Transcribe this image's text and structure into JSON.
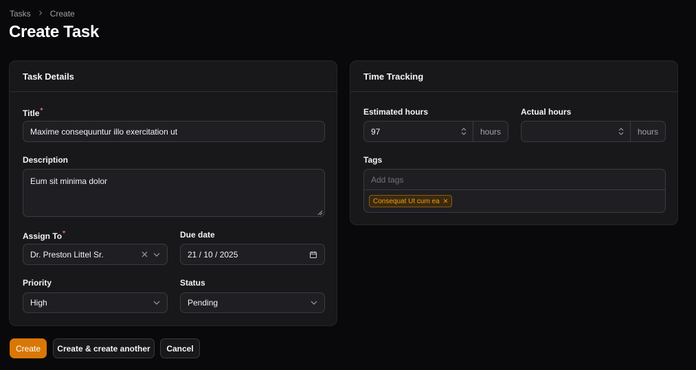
{
  "breadcrumb": {
    "items": [
      "Tasks",
      "Create"
    ]
  },
  "page": {
    "title": "Create Task"
  },
  "task_details": {
    "heading": "Task Details",
    "title": {
      "label": "Title",
      "required_mark": "*",
      "value": "Maxime consequuntur illo exercitation ut"
    },
    "description": {
      "label": "Description",
      "value": "Eum sit minima dolor"
    },
    "assign_to": {
      "label": "Assign To",
      "required_mark": "*",
      "value": "Dr. Preston Littel Sr."
    },
    "due_date": {
      "label": "Due date",
      "value": "21 / 10 / 2025"
    },
    "priority": {
      "label": "Priority",
      "value": "High"
    },
    "status": {
      "label": "Status",
      "value": "Pending"
    }
  },
  "time_tracking": {
    "heading": "Time Tracking",
    "estimated_hours": {
      "label": "Estimated hours",
      "value": "97",
      "suffix": "hours"
    },
    "actual_hours": {
      "label": "Actual hours",
      "value": "",
      "suffix": "hours"
    },
    "tags": {
      "label": "Tags",
      "placeholder": "Add tags",
      "items": [
        "Consequat Ut cum ea"
      ]
    }
  },
  "actions": {
    "create": "Create",
    "create_another": "Create & create another",
    "cancel": "Cancel"
  },
  "colors": {
    "accent": "#d97706",
    "background": "#09090b",
    "card": "#18181b",
    "required": "#f87171"
  }
}
